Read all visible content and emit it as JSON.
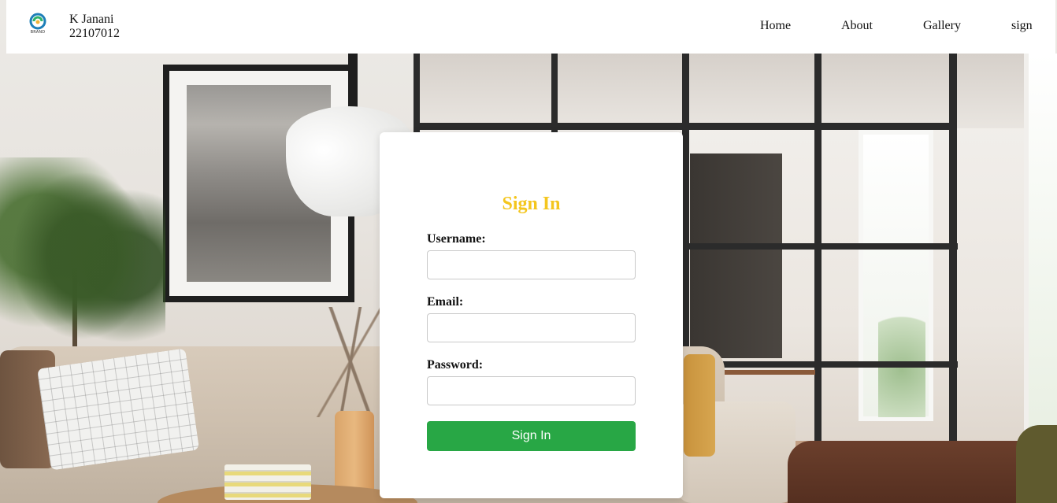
{
  "header": {
    "logo": {
      "text": "BRAND",
      "icon": "brand-swirl-icon",
      "colors": [
        "#1e7fb8",
        "#2fb36b",
        "#f0b43a"
      ]
    },
    "user_name": "K Janani",
    "user_id": "22107012",
    "nav": [
      {
        "label": "Home"
      },
      {
        "label": "About"
      },
      {
        "label": "Gallery"
      },
      {
        "label": "sign"
      }
    ]
  },
  "signin": {
    "title": "Sign In",
    "title_color": "#f4c61e",
    "fields": [
      {
        "label": "Username:",
        "value": "",
        "placeholder": ""
      },
      {
        "label": "Email:",
        "value": "",
        "placeholder": ""
      },
      {
        "label": "Password:",
        "value": "",
        "placeholder": ""
      }
    ],
    "submit_label": "Sign In",
    "submit_color": "#28a745"
  }
}
